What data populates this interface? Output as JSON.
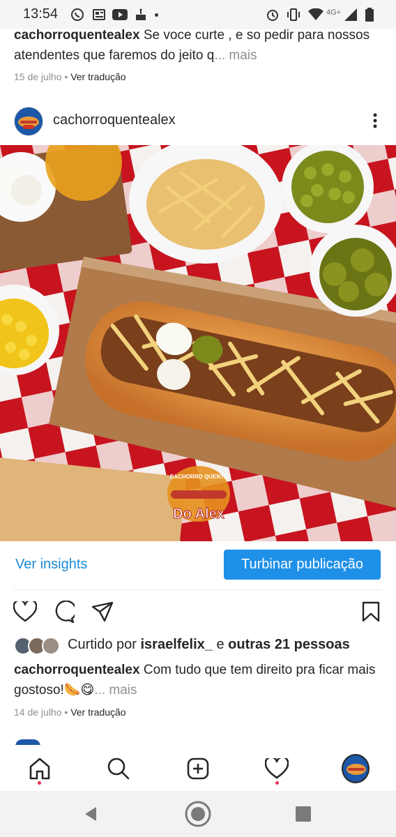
{
  "status_bar": {
    "time": "13:54",
    "network_label": "4G+"
  },
  "prev_post": {
    "username": "cachorroquentealex",
    "caption": "Se voce curte , e so pedir para nossos atendentes que faremos do jeito q",
    "more_label": "... mais",
    "date": "15 de julho",
    "separator": "•",
    "translate_label": "Ver tradução"
  },
  "post": {
    "username": "cachorroquentealex",
    "watermark_top": "CACHORRO QUENTE",
    "watermark_brand": "Do Alex",
    "insights_label": "Ver insights",
    "boost_label": "Turbinar publicação",
    "liked_prefix": "Curtido por ",
    "liked_user": "israelfelix_",
    "liked_and": " e ",
    "liked_others": "outras 21 pessoas",
    "caption_user": "cachorroquentealex",
    "caption_text": "Com tudo que tem direito pra ficar mais gostoso!🌭😋",
    "more_label": "... mais",
    "date": "14 de julho",
    "separator": "•",
    "translate_label": "Ver tradução"
  },
  "icons": {
    "status": [
      "whatsapp-icon",
      "news-icon",
      "youtube-icon",
      "cake-icon",
      "alarm-icon",
      "vibrate-icon",
      "wifi-icon",
      "signal-icon",
      "battery-icon"
    ],
    "actions": [
      "heart-icon",
      "comment-icon",
      "share-icon",
      "bookmark-icon"
    ],
    "nav": [
      "home-icon",
      "search-icon",
      "add-post-icon",
      "activity-heart-icon",
      "profile-avatar"
    ],
    "system": [
      "back-icon",
      "home-circle-icon",
      "recents-icon"
    ]
  },
  "colors": {
    "accent": "#1e90e8",
    "link": "#1a8ad6",
    "notification_dot": "#ed2d55",
    "muted_text": "#8e8e8e"
  }
}
